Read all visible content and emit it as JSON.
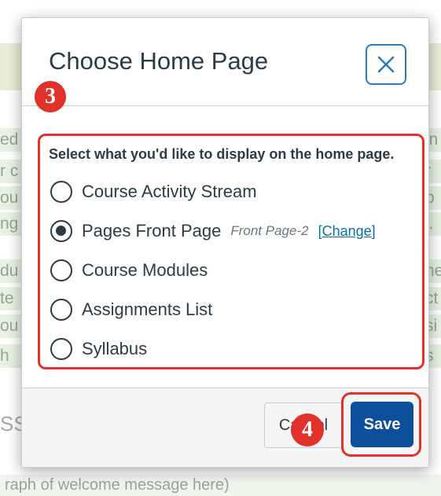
{
  "dialog": {
    "title": "Choose Home Page",
    "close_icon": "close-x-icon",
    "instructions": "Select what you'd like to display on the home page.",
    "selected_option": "Pages Front Page",
    "options": [
      {
        "label": "Course Activity Stream",
        "checked": false
      },
      {
        "label": "Pages Front Page",
        "checked": true,
        "page_name": "Front Page-2",
        "link_open": "[",
        "link_text": "Change",
        "link_close": "]"
      },
      {
        "label": "Course Modules",
        "checked": false
      },
      {
        "label": "Assignments List",
        "checked": false
      },
      {
        "label": "Syllabus",
        "checked": false
      }
    ],
    "cancel_label": "Cancel",
    "save_label": "Save"
  },
  "annotations": {
    "step_3": "3",
    "step_4": "4"
  },
  "background": {
    "left_fragments": [
      "ed",
      "r c",
      "ou",
      "ng",
      "du",
      "te",
      "ou",
      "h"
    ],
    "right_fragments": [
      "in",
      "r",
      "b",
      "l.",
      "he",
      "ct",
      "si",
      "s"
    ],
    "heading_fragment": "SS",
    "footer_text": "raph of welcome message here)"
  },
  "colors": {
    "annotation_red": "#e0322b",
    "save_blue": "#0e4f9c",
    "close_border": "#2b7abc",
    "link_blue": "#0770a3",
    "text_dark": "#2d3b45"
  }
}
